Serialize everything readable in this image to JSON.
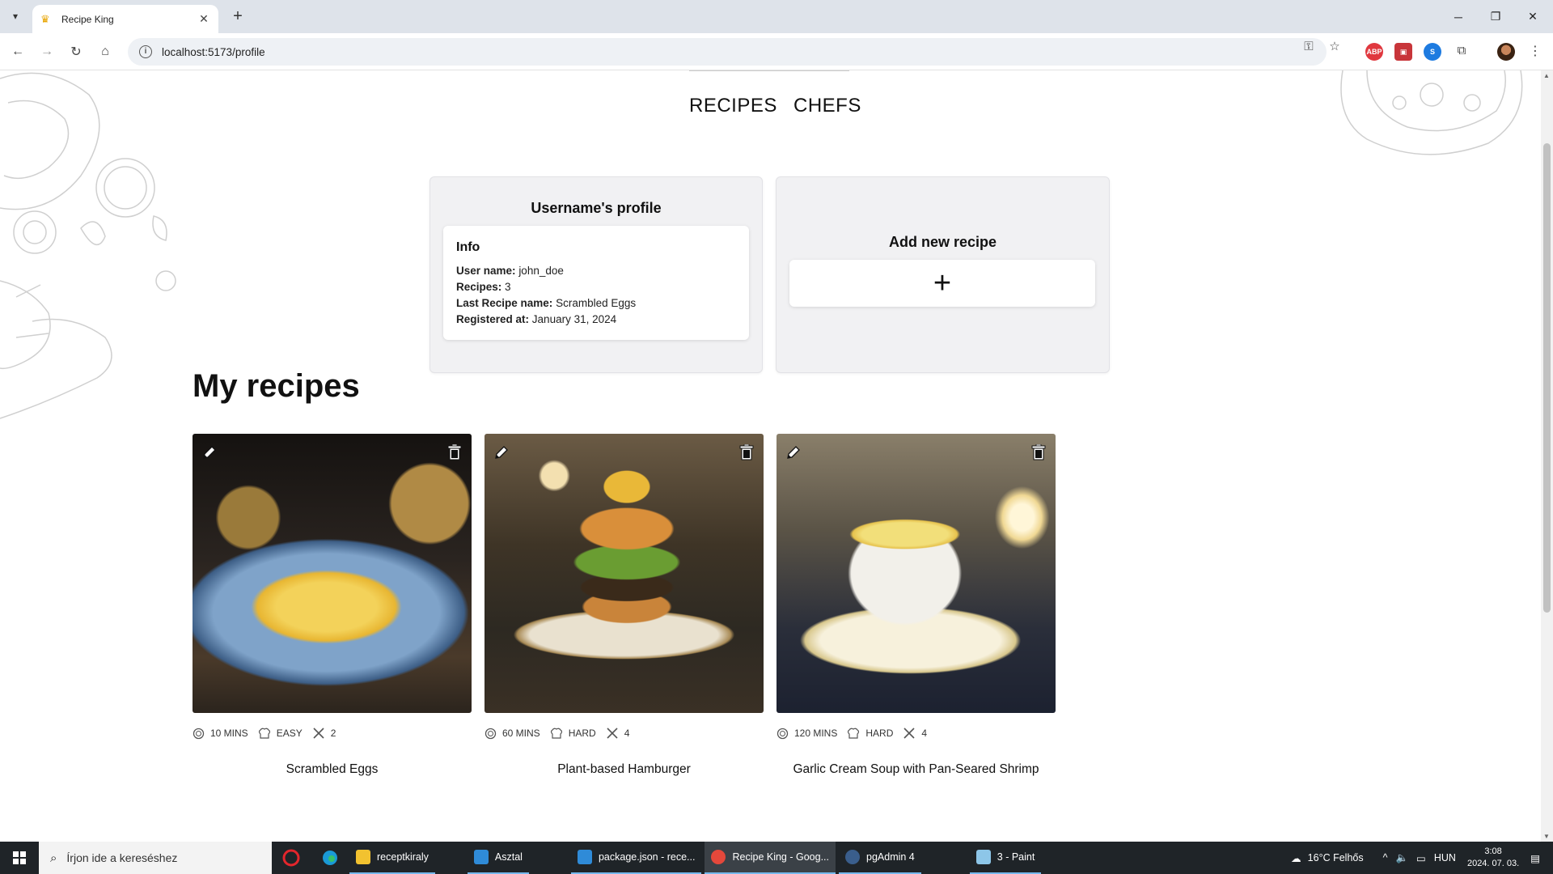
{
  "browser": {
    "tab_title": "Recipe King",
    "url": "localhost:5173/profile"
  },
  "nav": {
    "recipes": "RECIPES",
    "chefs": "CHEFS"
  },
  "profile": {
    "title": "Username's profile",
    "info_heading": "Info",
    "rows": [
      {
        "label": "User name:",
        "value": "john_doe"
      },
      {
        "label": "Recipes:",
        "value": "3"
      },
      {
        "label": "Last Recipe name:",
        "value": "Scrambled Eggs"
      },
      {
        "label": "Registered at:",
        "value": "January 31, 2024"
      }
    ]
  },
  "add_recipe": {
    "title": "Add new recipe",
    "plus": "+"
  },
  "my_recipes": {
    "title": "My recipes",
    "items": [
      {
        "name": "Scrambled Eggs",
        "time": "10 MINS",
        "difficulty": "EASY",
        "servings": "2"
      },
      {
        "name": "Plant-based Hamburger",
        "time": "60 MINS",
        "difficulty": "HARD",
        "servings": "4"
      },
      {
        "name": "Garlic Cream Soup with Pan-Seared Shrimp",
        "time": "120 MINS",
        "difficulty": "HARD",
        "servings": "4"
      }
    ]
  },
  "taskbar": {
    "search_placeholder": "Írjon ide a kereséshez",
    "apps": [
      {
        "label": "receptkiraly",
        "color": "#f2c230"
      },
      {
        "label": "Asztal",
        "color": "#2f8bd8"
      },
      {
        "label": "package.json - rece...",
        "color": "#2f8bd8"
      },
      {
        "label": "Recipe King - Goog...",
        "color": "#e4483b"
      },
      {
        "label": "pgAdmin 4",
        "color": "#3a5e8c"
      },
      {
        "label": "3 - Paint",
        "color": "#8dc6e8"
      }
    ],
    "weather": "16°C  Felhős",
    "lang": "HUN",
    "time": "3:08",
    "date": "2024. 07. 03."
  }
}
